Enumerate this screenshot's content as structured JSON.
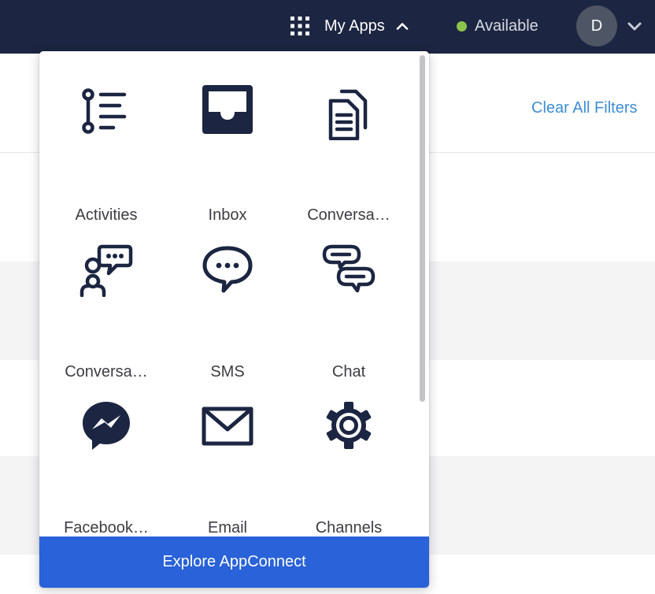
{
  "header": {
    "apps_menu_label": "My Apps",
    "status_label": "Available",
    "status_color": "#8bc34a",
    "avatar_initial": "D",
    "background_color": "#1c2541"
  },
  "page": {
    "clear_filters_label": "Clear All Filters"
  },
  "apps_menu": {
    "items": [
      {
        "label": "Activities",
        "icon": "activities-icon"
      },
      {
        "label": "Inbox",
        "icon": "inbox-icon"
      },
      {
        "label": "Conversa…",
        "icon": "conversations-icon"
      },
      {
        "label": "Conversa…",
        "icon": "conversation-assist-icon"
      },
      {
        "label": "SMS",
        "icon": "sms-icon"
      },
      {
        "label": "Chat",
        "icon": "chat-icon"
      },
      {
        "label": "Facebook…",
        "icon": "messenger-icon"
      },
      {
        "label": "Email",
        "icon": "email-icon"
      },
      {
        "label": "Channels",
        "icon": "gear-icon"
      }
    ],
    "footer_button_label": "Explore AppConnect",
    "icon_color": "#1c2541",
    "footer_button_color": "#2962d9"
  }
}
